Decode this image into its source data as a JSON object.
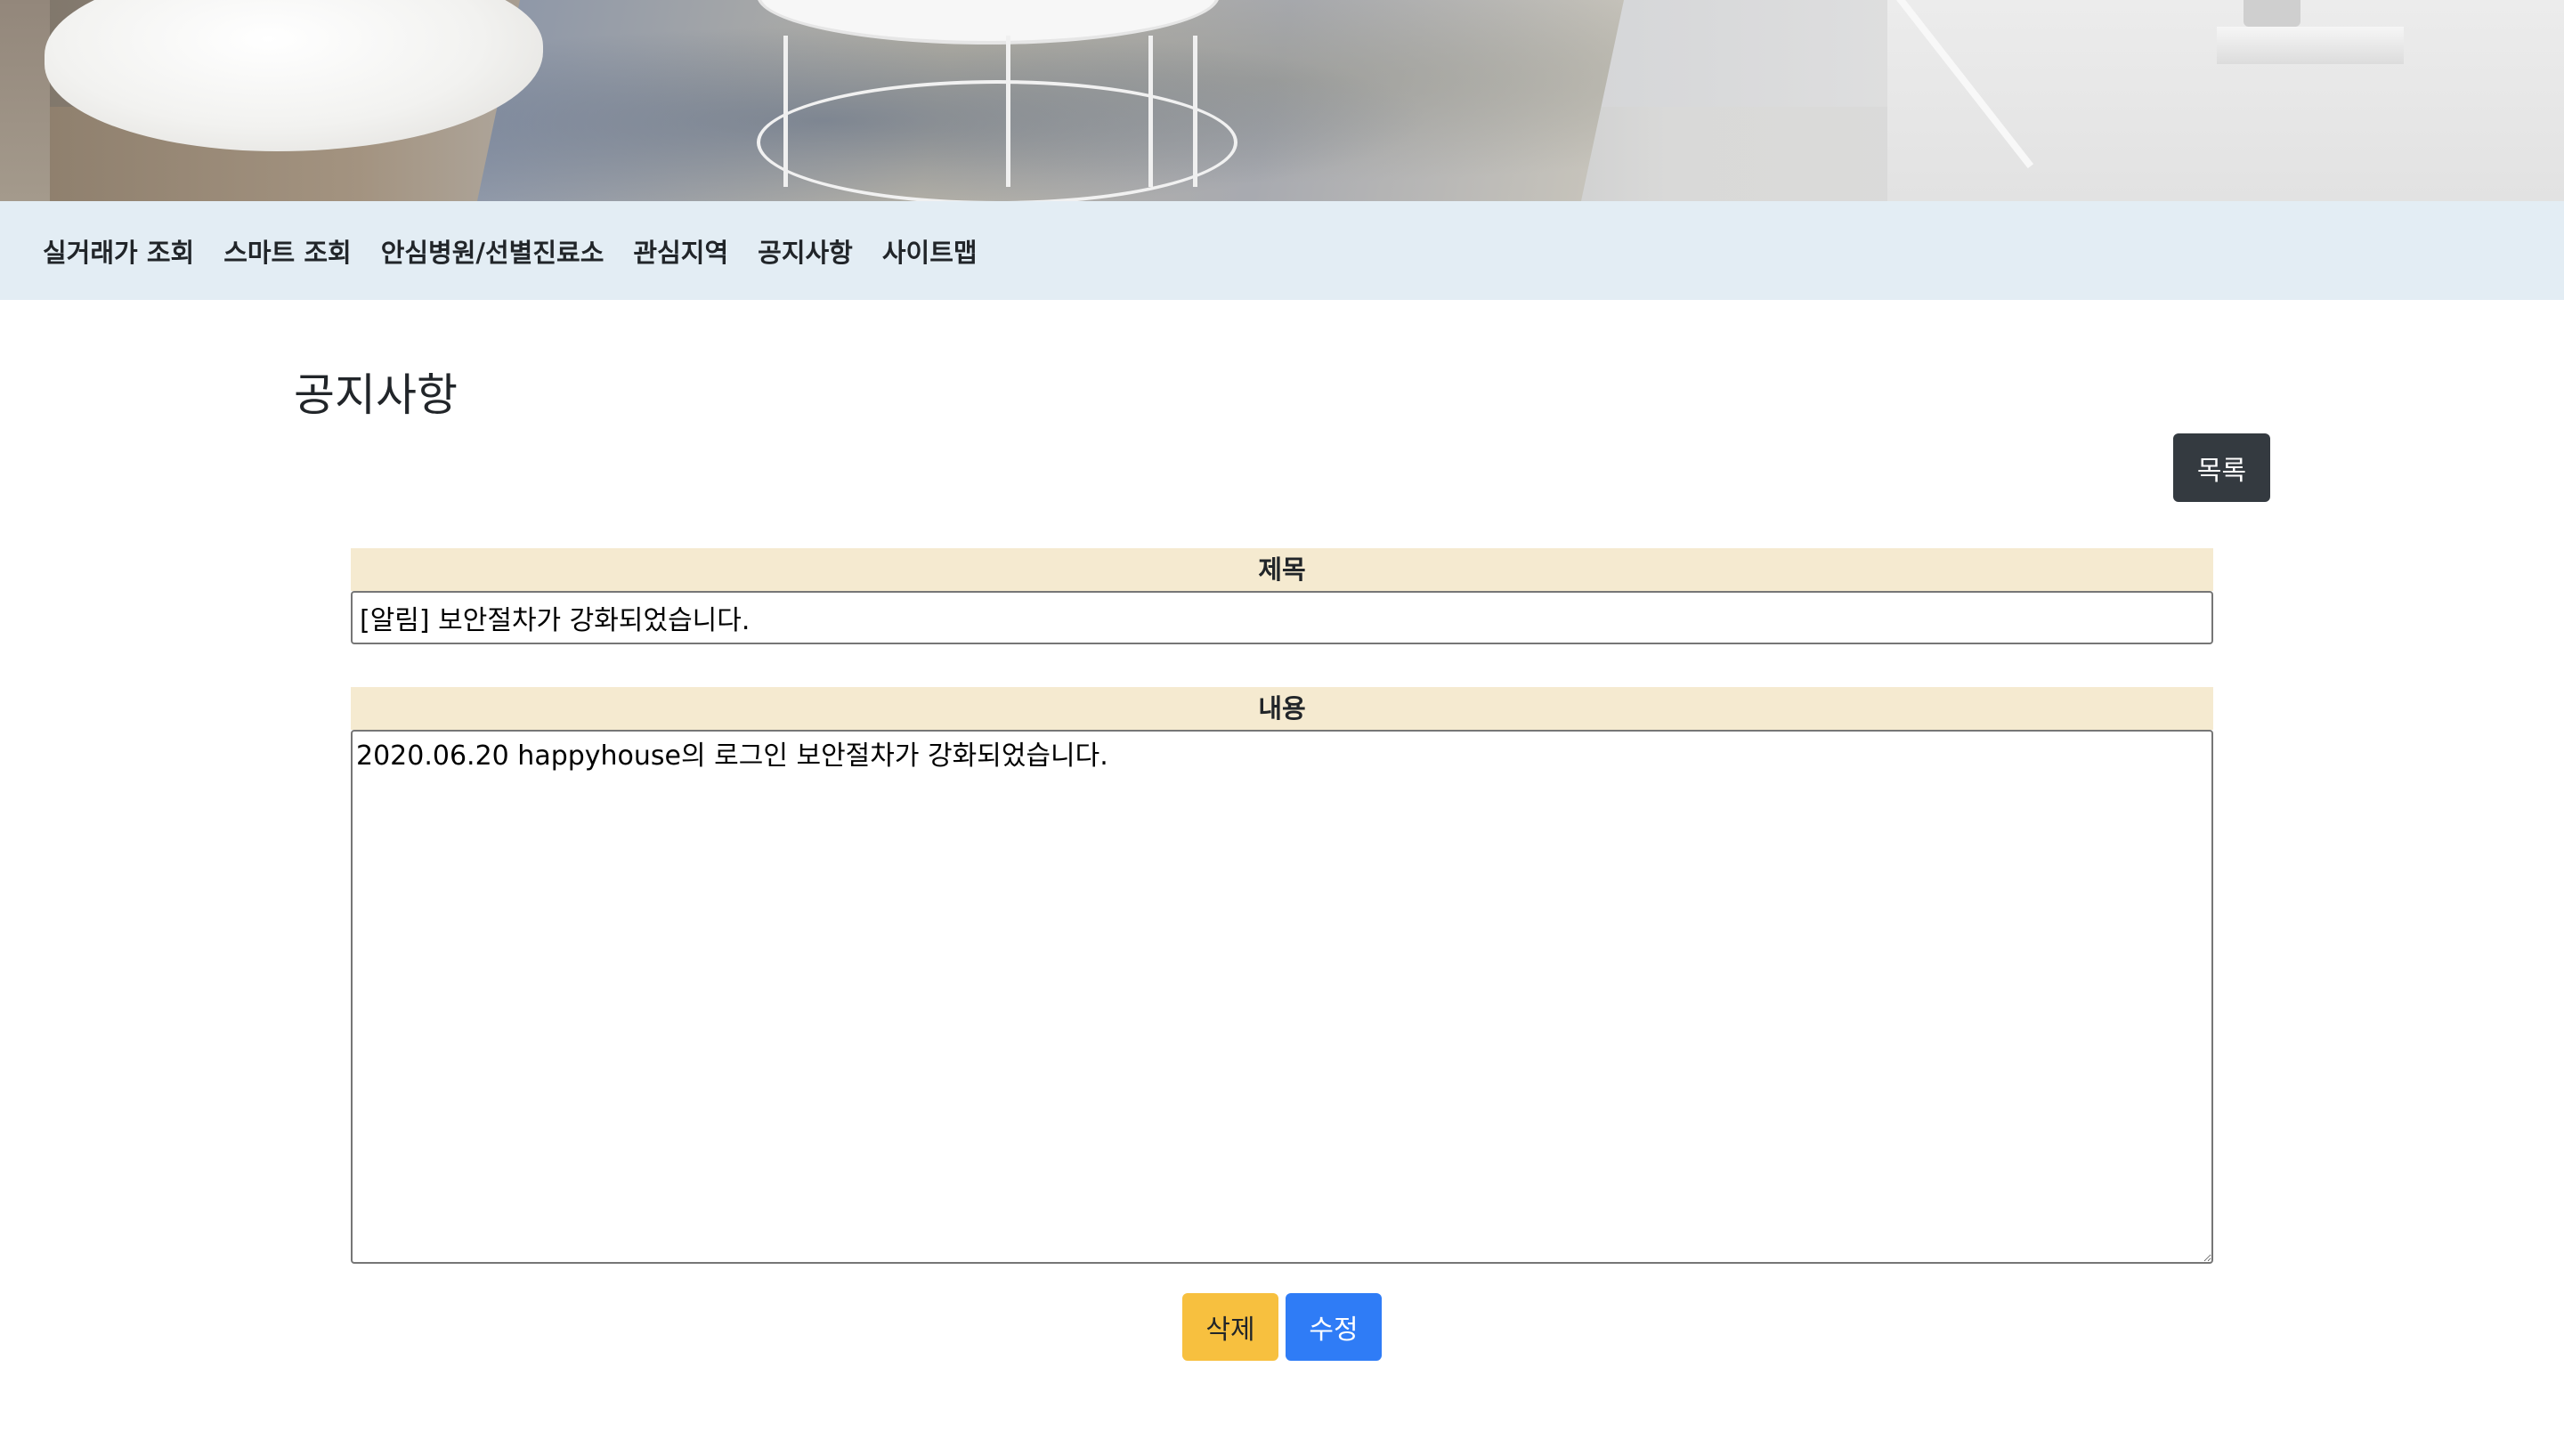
{
  "nav": {
    "items": [
      {
        "label": "실거래가 조회"
      },
      {
        "label": "스마트 조회"
      },
      {
        "label": "안심병원/선별진료소"
      },
      {
        "label": "관심지역"
      },
      {
        "label": "공지사항"
      },
      {
        "label": "사이트맵"
      }
    ]
  },
  "page": {
    "title": "공지사항",
    "list_button": "목록"
  },
  "form": {
    "title_label": "제목",
    "title_value": "[알림] 보안절차가 강화되었습니다.",
    "content_label": "내용",
    "content_value": "2020.06.20 happyhouse의 로그인 보안절차가 강화되었습니다."
  },
  "actions": {
    "delete_label": "삭제",
    "edit_label": "수정"
  },
  "colors": {
    "nav_bg": "#e3edf4",
    "label_bg": "#f5ead0",
    "list_button": "#343a40",
    "delete_button": "#f7c03f",
    "edit_button": "#2f7cf6"
  }
}
